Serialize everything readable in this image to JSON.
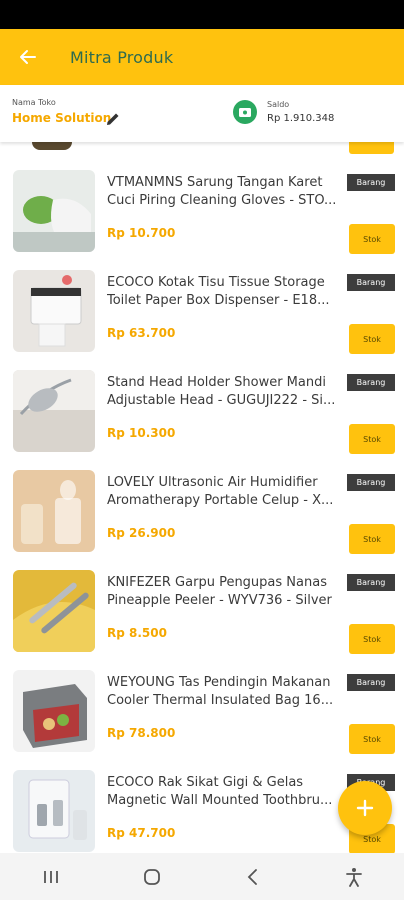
{
  "app_bar": {
    "title": "Mitra Produk",
    "back_icon": "arrow-left-icon"
  },
  "store": {
    "label": "Nama Toko",
    "name": "Home Solution",
    "saldo_label": "Saldo",
    "saldo_value": "Rp 1.910.348"
  },
  "colors": {
    "accent": "#FFC20E",
    "price": "#F5A800",
    "badge": "#3d3d3d",
    "wallet": "#2aa860"
  },
  "products": [
    {
      "name": "VTMANMNS Sarung Tangan Karet Cuci Piring Cleaning Gloves - STO...",
      "price": "Rp 10.700",
      "badge": "Barang",
      "stok": "Stok"
    },
    {
      "name": "ECOCO Kotak Tisu Tissue Storage Toilet Paper Box Dispenser - E18...",
      "price": "Rp 63.700",
      "badge": "Barang",
      "stok": "Stok"
    },
    {
      "name": "Stand Head Holder Shower Mandi Adjustable Head - GUGUJI222 - Si...",
      "price": "Rp 10.300",
      "badge": "Barang",
      "stok": "Stok"
    },
    {
      "name": "LOVELY Ultrasonic Air Humidifier Aromatherapy Portable Celup - X...",
      "price": "Rp 26.900",
      "badge": "Barang",
      "stok": "Stok"
    },
    {
      "name": "KNIFEZER Garpu Pengupas Nanas Pineapple Peeler - WYV736 - Silver",
      "price": "Rp 8.500",
      "badge": "Barang",
      "stok": "Stok"
    },
    {
      "name": "WEYOUNG Tas Pendingin Makanan Cooler Thermal Insulated Bag 16...",
      "price": "Rp 78.800",
      "badge": "Barang",
      "stok": "Stok"
    },
    {
      "name": "ECOCO Rak Sikat Gigi & Gelas Magnetic Wall Mounted Toothbru...",
      "price": "Rp 47.700",
      "badge": "Barang",
      "stok": "Stok"
    }
  ],
  "fab": {
    "icon": "plus-icon"
  },
  "nav": {
    "recents": "recents-icon",
    "home": "home-icon",
    "back": "back-icon",
    "accessibility": "accessibility-icon"
  }
}
